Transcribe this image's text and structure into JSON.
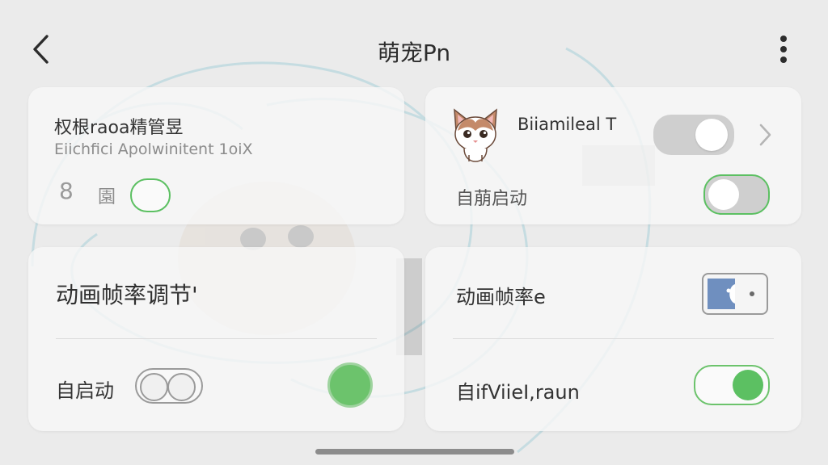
{
  "header": {
    "title": "萌宠Pn",
    "back_icon": "chevron-left-icon",
    "more_icon": "more-vertical-icon"
  },
  "card1": {
    "title": "权根raoa精管昱",
    "subtitle": "Eiichfici Apolwinitent 1oiX",
    "badge_glyph": "8",
    "label": "園"
  },
  "card2": {
    "pet_icon": "cat-avatar-icon",
    "title": "Biiamileal T",
    "row_label": "自萠启动",
    "chevron_icon": "chevron-right-icon"
  },
  "card3": {
    "title": "动画帧率调节'",
    "row_label": "自启动"
  },
  "card4": {
    "title": "动画帧率e",
    "theme_icon": "moon-theme-icon",
    "row_label": "自ifViieI,raun"
  },
  "colors": {
    "accent_green": "#5cc062",
    "toggle_off": "#cfcfcf",
    "theme_blue": "#6f8fbf"
  }
}
